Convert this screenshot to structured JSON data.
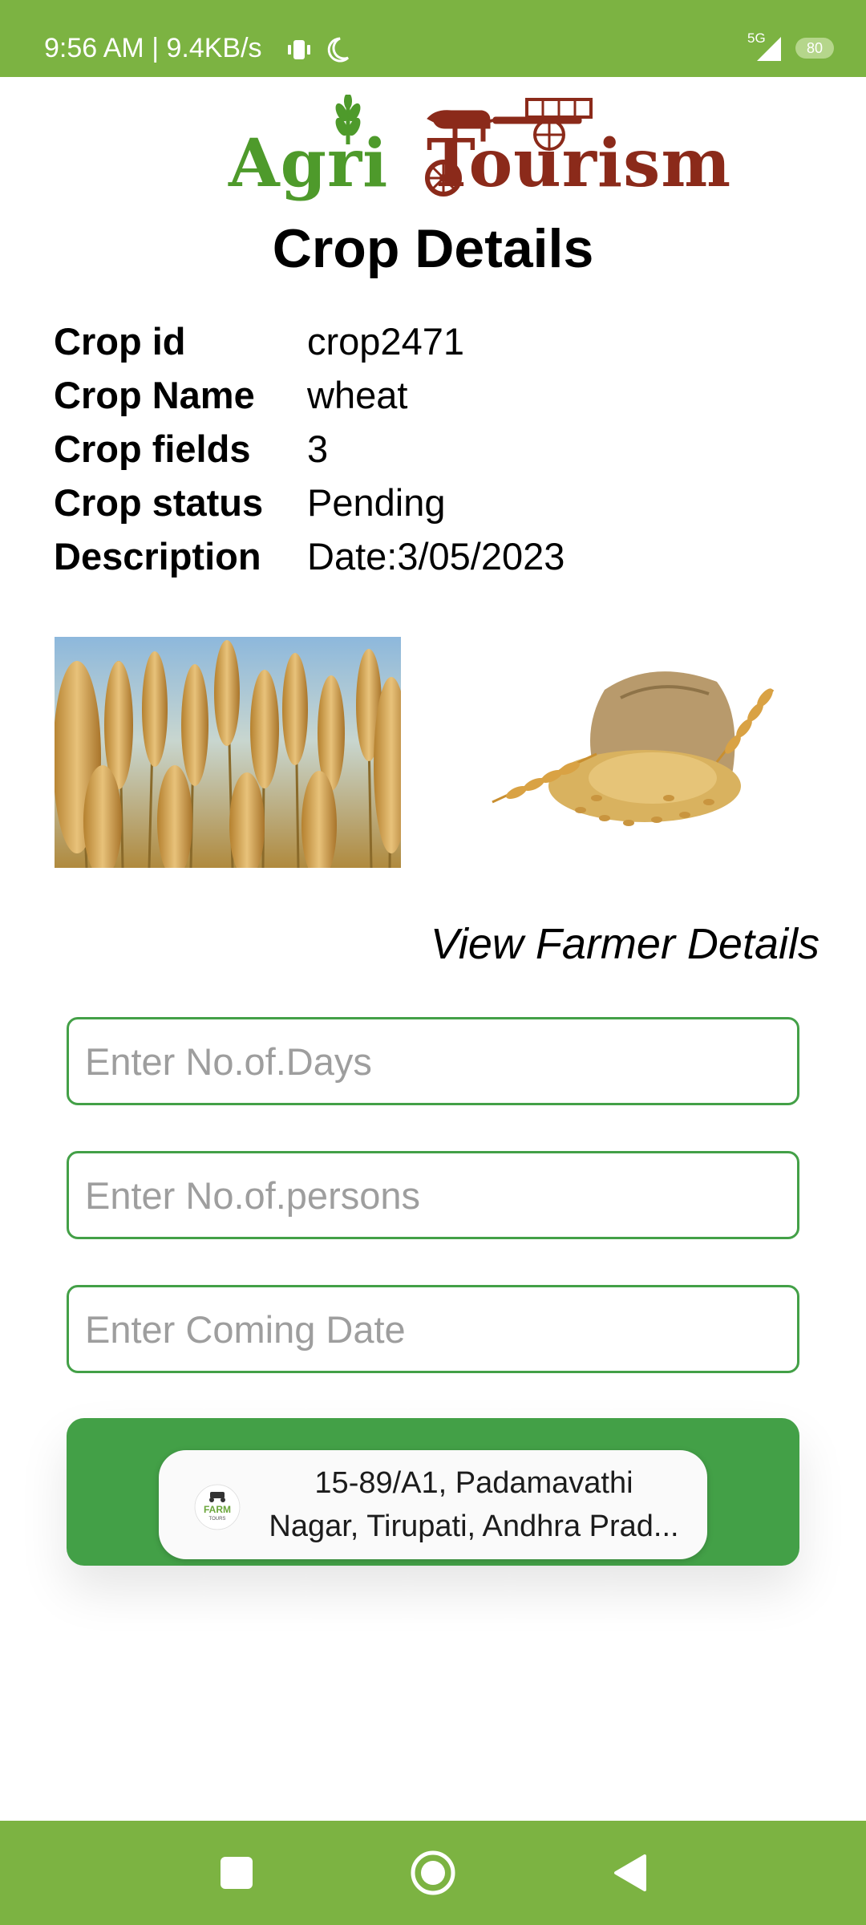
{
  "status_bar": {
    "time_speed": "9:56 AM | 9.4KB/s",
    "network": "5G",
    "battery": "80",
    "icons": [
      "vibrate-icon",
      "moon-icon",
      "signal-icon",
      "battery-icon"
    ]
  },
  "header": {
    "logo_agri": "Agri",
    "logo_tourism": "Tourism",
    "title": "Crop Details"
  },
  "details": [
    {
      "label": "Crop id",
      "value": "crop2471"
    },
    {
      "label": "Crop Name",
      "value": "wheat"
    },
    {
      "label": "Crop fields",
      "value": "3"
    },
    {
      "label": "Crop status",
      "value": "Pending"
    },
    {
      "label": "Description",
      "value": "Date:3/05/2023"
    }
  ],
  "images": [
    "wheat-field-photo",
    "wheat-grain-sack-photo"
  ],
  "link": {
    "view_farmer": "View Farmer Details"
  },
  "form": {
    "days_placeholder": "Enter No.of.Days",
    "persons_placeholder": "Enter No.of.persons",
    "date_placeholder": "Enter Coming Date"
  },
  "toast": {
    "line1": "15-89/A1, Padamavathi",
    "line2": "Nagar, Tirupati, Andhra Prad...",
    "icon_line1": "FARM",
    "icon_line2": "TOURS"
  },
  "nav": [
    "recents-square-icon",
    "home-circle-icon",
    "back-triangle-icon"
  ],
  "colors": {
    "bars": "#7cb342",
    "accent_green": "#43a047",
    "logo_green": "#4e9a2b",
    "logo_brown": "#8b2a1a"
  }
}
